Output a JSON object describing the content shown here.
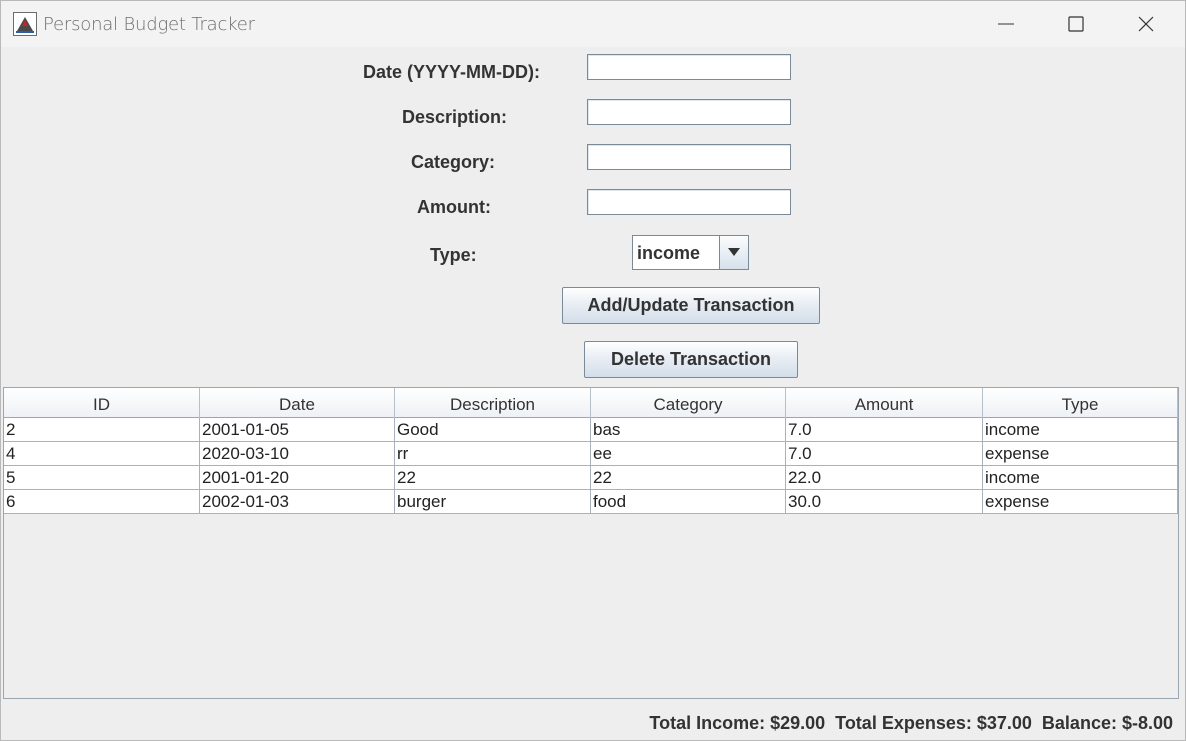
{
  "window": {
    "title": "Personal Budget Tracker"
  },
  "form": {
    "date_label": "Date (YYYY-MM-DD):",
    "date_value": "",
    "description_label": "Description:",
    "description_value": "",
    "category_label": "Category:",
    "category_value": "",
    "amount_label": "Amount:",
    "amount_value": "",
    "type_label": "Type:",
    "type_selected": "income",
    "add_button": "Add/Update Transaction",
    "delete_button": "Delete Transaction"
  },
  "table": {
    "columns": [
      "ID",
      "Date",
      "Description",
      "Category",
      "Amount",
      "Type"
    ],
    "rows": [
      [
        "2",
        "2001-01-05",
        "Good",
        "bas",
        "7.0",
        "income"
      ],
      [
        "4",
        "2020-03-10",
        "rr",
        "ee",
        "7.0",
        "expense"
      ],
      [
        "5",
        "2001-01-20",
        "22",
        "22",
        "22.0",
        "income"
      ],
      [
        "6",
        "2002-01-03",
        "burger",
        "food",
        "30.0",
        "expense"
      ]
    ]
  },
  "summary": {
    "total_income": "Total Income: $29.00",
    "total_expenses": "Total Expenses: $37.00",
    "balance": "Balance: $-8.00"
  },
  "icons": {
    "app": "java-app-icon",
    "minimize": "minimize-icon",
    "maximize": "maximize-icon",
    "close": "close-icon",
    "dropdown": "triangle-down-icon"
  }
}
